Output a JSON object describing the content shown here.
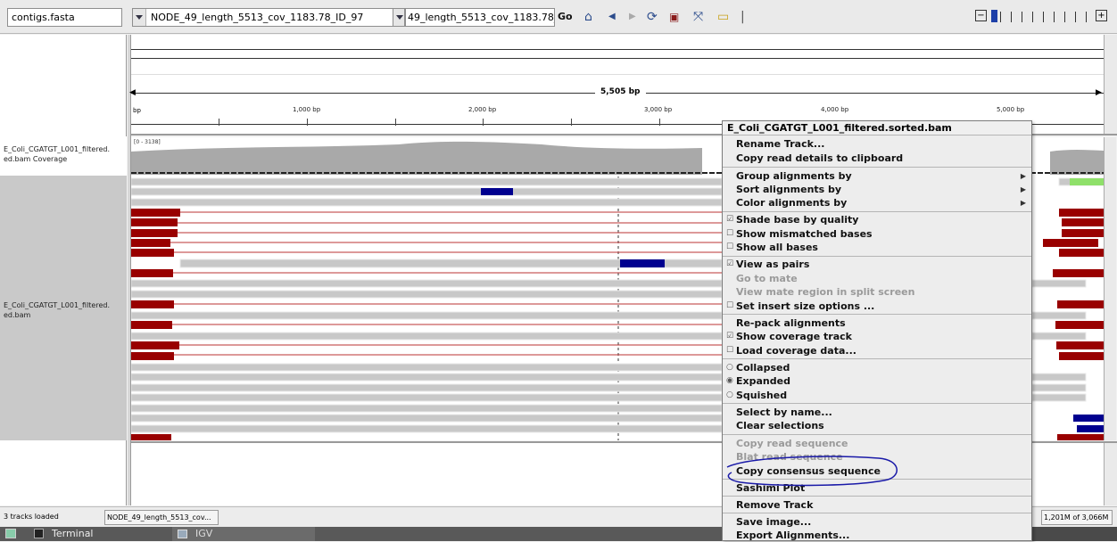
{
  "toolbar": {
    "genome": "contigs.fasta",
    "chromosome": "NODE_49_length_5513_cov_1183.78_ID_97",
    "locus": "49_length_5513_cov_1183.78_ID_97",
    "go_label": "Go",
    "icons": [
      "home-icon",
      "back-icon",
      "forward-icon",
      "refresh-icon",
      "region-icon",
      "resize-icon",
      "popup-text-icon"
    ]
  },
  "ruler": {
    "span_label": "5,505 bp",
    "start_label": "bp",
    "ticks": [
      "1,000 bp",
      "2,000 bp",
      "3,000 bp",
      "4,000 bp",
      "5,000 bp"
    ]
  },
  "tracks": {
    "coverage_name": "E_Coli_CGATGT_L001_filtered.sorted.bam Coverage",
    "coverage_name_display_1": "E_Coli_CGATGT_L001_filtered.",
    "coverage_name_display_2": "ed.bam Coverage",
    "coverage_range": "[0 - 3138]",
    "alignment_name_display_1": "E_Coli_CGATGT_L001_filtered.",
    "alignment_name_display_2": "ed.bam"
  },
  "menu": {
    "title": "E_Coli_CGATGT_L001_filtered.sorted.bam",
    "items": [
      {
        "label": "Rename Track..."
      },
      {
        "label": "Copy read details to clipboard"
      },
      {
        "label": "Group alignments by"
      },
      {
        "label": "Sort alignments by"
      },
      {
        "label": "Color alignments by"
      },
      {
        "label": "Shade base by quality"
      },
      {
        "label": "Show mismatched bases"
      },
      {
        "label": "Show all bases"
      },
      {
        "label": "View as pairs"
      },
      {
        "label": "Go to mate"
      },
      {
        "label": "View mate region in split screen"
      },
      {
        "label": "Set insert size options ..."
      },
      {
        "label": "Re-pack alignments"
      },
      {
        "label": "Show coverage track"
      },
      {
        "label": "Load coverage data..."
      },
      {
        "label": "Collapsed"
      },
      {
        "label": "Expanded"
      },
      {
        "label": "Squished"
      },
      {
        "label": "Select by name..."
      },
      {
        "label": "Clear selections"
      },
      {
        "label": "Copy read sequence"
      },
      {
        "label": "Blat read sequence"
      },
      {
        "label": "Copy consensus sequence"
      },
      {
        "label": "Sashimi Plot"
      },
      {
        "label": "Remove Track"
      },
      {
        "label": "Save image..."
      },
      {
        "label": "Export Alignments..."
      }
    ]
  },
  "status": {
    "tracks_loaded": "3 tracks loaded",
    "locus": "NODE_49_length_5513_cov...",
    "memory": "1,201M of 3,066M"
  },
  "taskbar": {
    "terminal": "Terminal",
    "igv": "IGV"
  },
  "colors": {
    "read_gray": "#c8c8c8",
    "read_red": "#990000",
    "read_blue": "#00008f",
    "read_green": "#8fe06a",
    "coverage": "#a9a9a9",
    "annotation_circle": "#1a1aa8"
  }
}
